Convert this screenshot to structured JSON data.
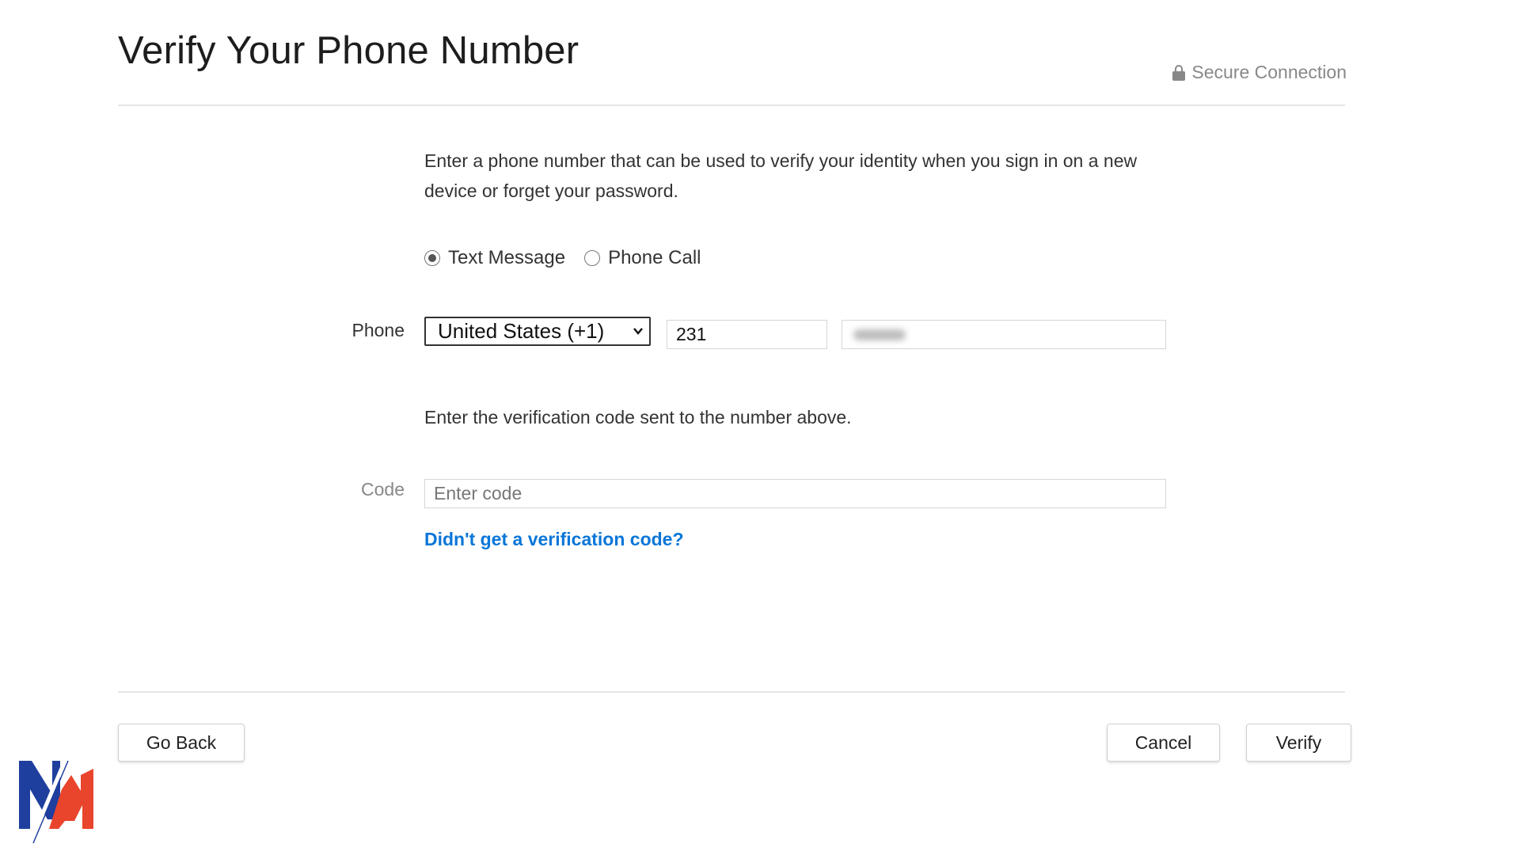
{
  "header": {
    "title": "Verify Your Phone Number",
    "secure_label": "Secure Connection",
    "secure_icon": "lock-icon"
  },
  "intro_text": "Enter a phone number that can be used to verify your identity when you sign in on a new device or forget your password.",
  "method": {
    "options": [
      {
        "label": "Text Message",
        "selected": true
      },
      {
        "label": "Phone Call",
        "selected": false
      }
    ]
  },
  "phone": {
    "label": "Phone",
    "country_value": "United States (+1)",
    "area_code_value": "231",
    "number_value": "(blurred)"
  },
  "code_section": {
    "prompt": "Enter the verification code sent to the number above.",
    "label": "Code",
    "placeholder": "Enter code",
    "help_link": "Didn't get a verification code?"
  },
  "footer": {
    "go_back_label": "Go Back",
    "cancel_label": "Cancel",
    "verify_label": "Verify"
  },
  "colors": {
    "link": "#0a76d8",
    "logo_blue": "#1e3f9e",
    "logo_red": "#e8452c"
  }
}
